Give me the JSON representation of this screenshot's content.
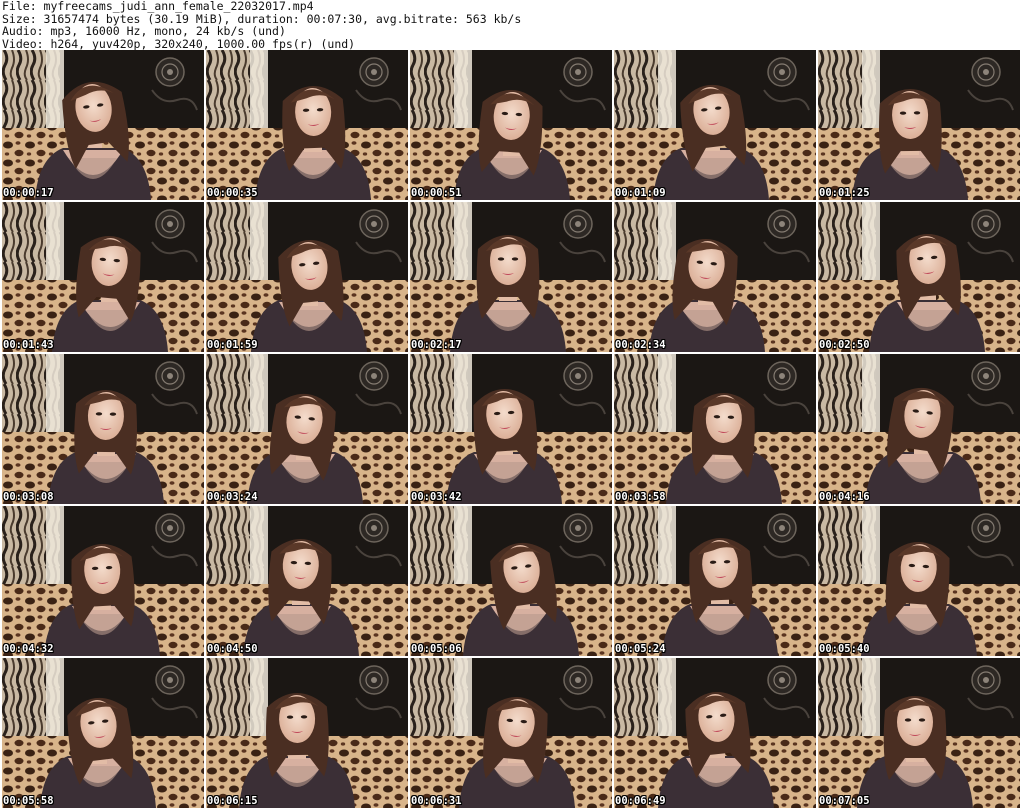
{
  "header": {
    "file_line": "File: myfreecams_judi_ann_female_22032017.mp4",
    "size_line": "Size: 31657474 bytes (30.19 MiB), duration: 00:07:30, avg.bitrate: 563 kb/s",
    "audio_line": "Audio: mp3, 16000 Hz, mono, 24 kb/s (und)",
    "video_line": "Video: h264, yuv420p, 320x240, 1000.00 fps(r) (und)"
  },
  "thumbnails": [
    {
      "timestamp": "00:00:17"
    },
    {
      "timestamp": "00:00:35"
    },
    {
      "timestamp": "00:00:51"
    },
    {
      "timestamp": "00:01:09"
    },
    {
      "timestamp": "00:01:25"
    },
    {
      "timestamp": "00:01:43"
    },
    {
      "timestamp": "00:01:59"
    },
    {
      "timestamp": "00:02:17"
    },
    {
      "timestamp": "00:02:34"
    },
    {
      "timestamp": "00:02:50"
    },
    {
      "timestamp": "00:03:08"
    },
    {
      "timestamp": "00:03:24"
    },
    {
      "timestamp": "00:03:42"
    },
    {
      "timestamp": "00:03:58"
    },
    {
      "timestamp": "00:04:16"
    },
    {
      "timestamp": "00:04:32"
    },
    {
      "timestamp": "00:04:50"
    },
    {
      "timestamp": "00:05:06"
    },
    {
      "timestamp": "00:05:24"
    },
    {
      "timestamp": "00:05:40"
    },
    {
      "timestamp": "00:05:58"
    },
    {
      "timestamp": "00:06:15"
    },
    {
      "timestamp": "00:06:31"
    },
    {
      "timestamp": "00:06:49"
    },
    {
      "timestamp": "00:07:05"
    }
  ]
}
